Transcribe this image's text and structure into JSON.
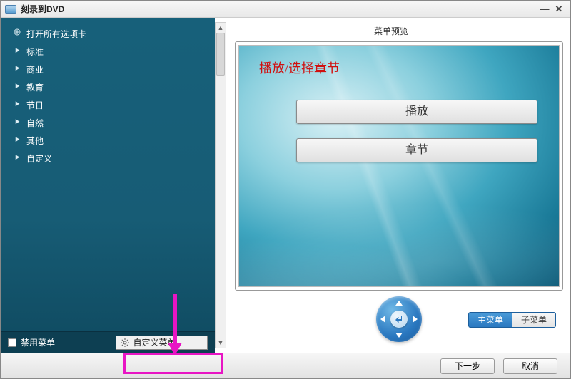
{
  "titlebar": {
    "title": "刻录到DVD"
  },
  "sidebar": {
    "items": [
      {
        "label": "打开所有选项卡",
        "open": true
      },
      {
        "label": "标准"
      },
      {
        "label": "商业"
      },
      {
        "label": "教育"
      },
      {
        "label": "节日"
      },
      {
        "label": "自然"
      },
      {
        "label": "其他"
      },
      {
        "label": "自定义"
      }
    ],
    "disable_label": "禁用菜单",
    "custom_label": "自定义菜单"
  },
  "preview": {
    "title": "菜单预览",
    "heading": "播放/选择章节",
    "play_label": "播放",
    "chapter_label": "章节",
    "main_menu_label": "主菜单",
    "sub_menu_label": "子菜单"
  },
  "footer": {
    "next_label": "下一步",
    "cancel_label": "取消"
  }
}
